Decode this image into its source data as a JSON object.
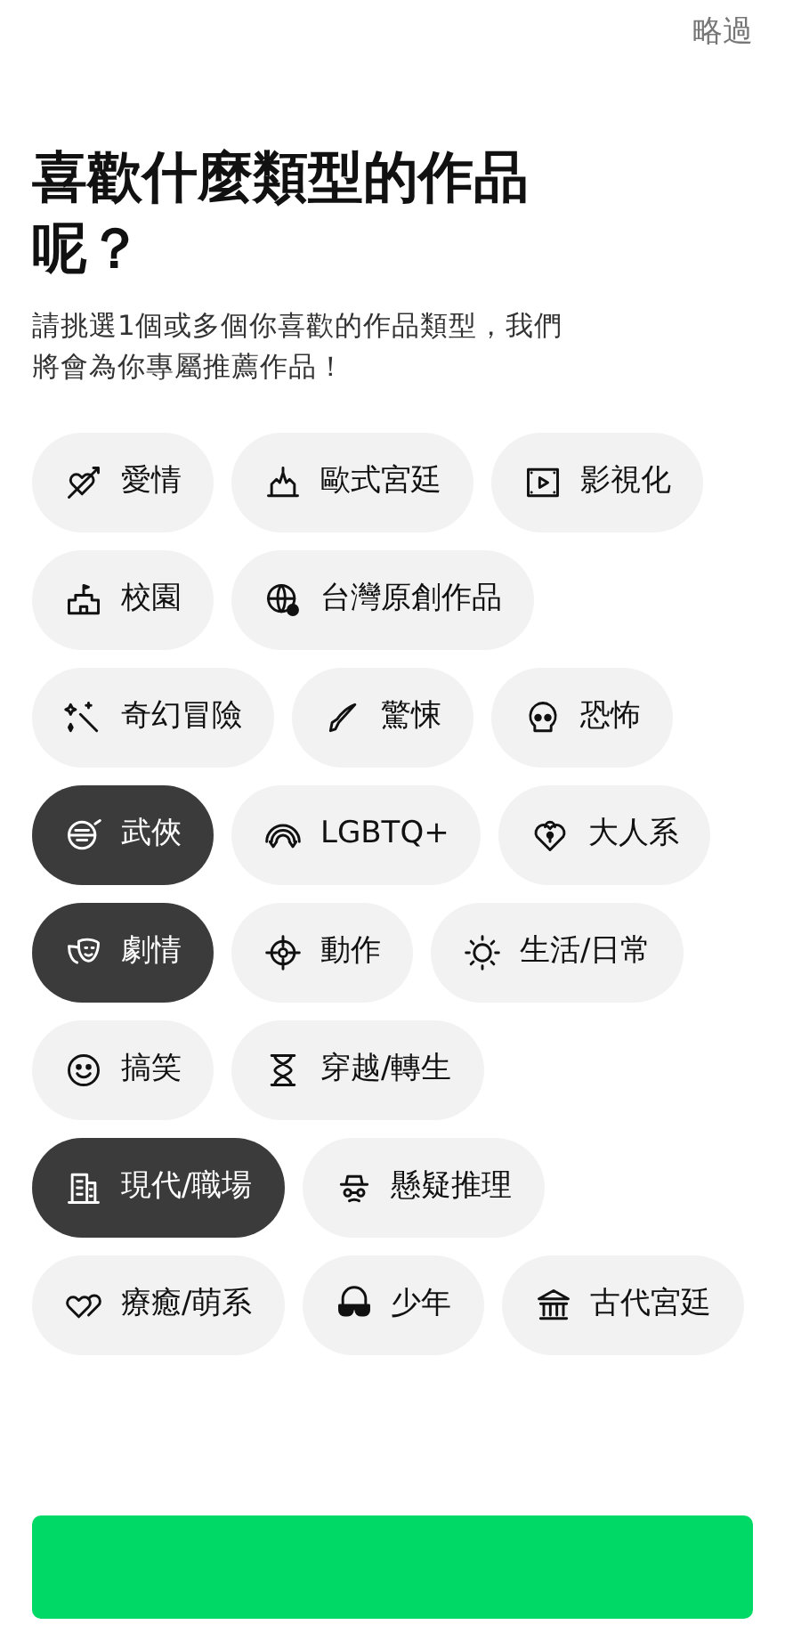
{
  "skip": "略過",
  "title": "喜歡什麼類型的作品呢？",
  "subtitle": "請挑選1個或多個你喜歡的作品類型，我們將會為你專屬推薦作品！",
  "genres": [
    {
      "label": "愛情",
      "selected": false
    },
    {
      "label": "歐式宮廷",
      "selected": false
    },
    {
      "label": "影視化",
      "selected": false
    },
    {
      "label": "校園",
      "selected": false
    },
    {
      "label": "台灣原創作品",
      "selected": false
    },
    {
      "label": "奇幻冒險",
      "selected": false
    },
    {
      "label": "驚悚",
      "selected": false
    },
    {
      "label": "恐怖",
      "selected": false
    },
    {
      "label": "武俠",
      "selected": true
    },
    {
      "label": "LGBTQ+",
      "selected": false
    },
    {
      "label": "大人系",
      "selected": false
    },
    {
      "label": "劇情",
      "selected": true
    },
    {
      "label": "動作",
      "selected": false
    },
    {
      "label": "生活/日常",
      "selected": false
    },
    {
      "label": "搞笑",
      "selected": false
    },
    {
      "label": "穿越/轉生",
      "selected": false
    },
    {
      "label": "現代/職場",
      "selected": true
    },
    {
      "label": "懸疑推理",
      "selected": false
    },
    {
      "label": "療癒/萌系",
      "selected": false
    },
    {
      "label": "少年",
      "selected": false
    },
    {
      "label": "古代宮廷",
      "selected": false
    }
  ],
  "next_button": {
    "kind": "primary"
  }
}
